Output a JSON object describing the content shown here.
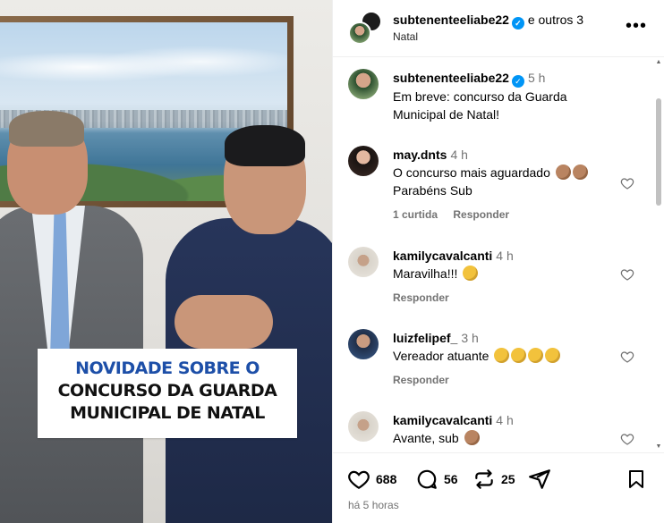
{
  "post": {
    "header": {
      "username": "subtenenteeliabe22",
      "others": "e outros 3",
      "location": "Natal"
    },
    "media": {
      "caption_lines": [
        "NOVIDADE SOBRE O",
        "CONCURSO DA GUARDA",
        "MUNICIPAL DE NATAL"
      ]
    },
    "main_comment": {
      "username": "subtenenteeliabe22",
      "time": "5 h",
      "text": "Em breve: concurso da Guarda Municipal de Natal!"
    },
    "comments": [
      {
        "username": "may.dnts",
        "time": "4 h",
        "text": "O concurso mais aguardado",
        "text2": "Parabéns Sub",
        "likes": "1 curtida",
        "reply": "Responder"
      },
      {
        "username": "kamilycavalcanti",
        "time": "4 h",
        "text": "Maravilha!!!",
        "reply": "Responder"
      },
      {
        "username": "luizfelipef_",
        "time": "3 h",
        "text": "Vereador atuante",
        "reply": "Responder"
      },
      {
        "username": "kamilycavalcanti",
        "time": "4 h",
        "text": "Avante, sub"
      }
    ],
    "actions": {
      "likes": "688",
      "comments": "56",
      "reposts": "25"
    },
    "ago": "há 5 horas"
  },
  "icons": [
    "more-icon",
    "verified-icon",
    "heart-icon",
    "comment-icon",
    "repost-icon",
    "share-icon",
    "bookmark-icon",
    "clap-emoji-icon"
  ]
}
